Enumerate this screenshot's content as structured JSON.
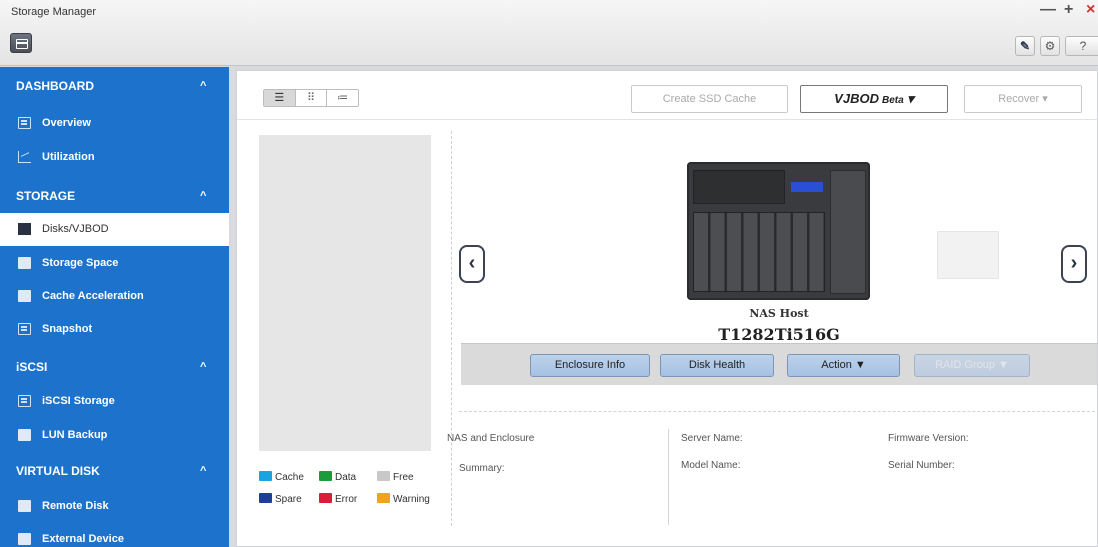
{
  "window": {
    "title": "Storage Manager",
    "controls": {
      "minimize": "—",
      "maximize": "+",
      "close": "×"
    },
    "tools": [
      "?"
    ]
  },
  "sidebar": {
    "sections": [
      {
        "label": "DASHBOARD",
        "items": [
          {
            "label": "Overview",
            "icon": "overview-icon"
          },
          {
            "label": "Utilization",
            "icon": "chart-icon"
          }
        ]
      },
      {
        "label": "STORAGE",
        "items": [
          {
            "label": "Disks/VJBOD",
            "icon": "disk-icon",
            "active": true
          },
          {
            "label": "Storage Space",
            "icon": "storage-icon"
          },
          {
            "label": "Cache Acceleration",
            "icon": "cache-icon"
          },
          {
            "label": "Snapshot",
            "icon": "snapshot-icon"
          }
        ]
      },
      {
        "label": "iSCSI",
        "items": [
          {
            "label": "iSCSI Storage",
            "icon": "iscsi-icon"
          },
          {
            "label": "LUN Backup",
            "icon": "backup-icon"
          }
        ]
      },
      {
        "label": "VIRTUAL DISK",
        "items": [
          {
            "label": "Remote Disk",
            "icon": "remote-icon"
          },
          {
            "label": "External Device",
            "icon": "external-icon"
          }
        ]
      }
    ]
  },
  "toolbar": {
    "create_ssd_cache": "Create SSD Cache",
    "vjbod": "VJBOD",
    "vjbod_badge": "Beta",
    "recover": "Recover"
  },
  "legend": [
    {
      "label": "Cache",
      "color": "#1aa3e0"
    },
    {
      "label": "Data",
      "color": "#1c9b3c"
    },
    {
      "label": "Free",
      "color": "#c8c8c8"
    },
    {
      "label": "Spare",
      "color": "#1e3e99"
    },
    {
      "label": "Error",
      "color": "#d81f3a"
    },
    {
      "label": "Warning",
      "color": "#f2a31b"
    }
  ],
  "device": {
    "label": "NAS Host",
    "model": "T1282Ti516G"
  },
  "actions": {
    "enclosure_info": "Enclosure Info",
    "disk_health": "Disk Health",
    "action": "Action ▼",
    "raid_group": "RAID Group ▼"
  },
  "info": {
    "nas_and_enclosure": "NAS and Enclosure",
    "summary": "Summary:",
    "server_name": "Server Name:",
    "model_name": "Model Name:",
    "firmware_version": "Firmware Version:",
    "serial_number": "Serial Number:"
  }
}
